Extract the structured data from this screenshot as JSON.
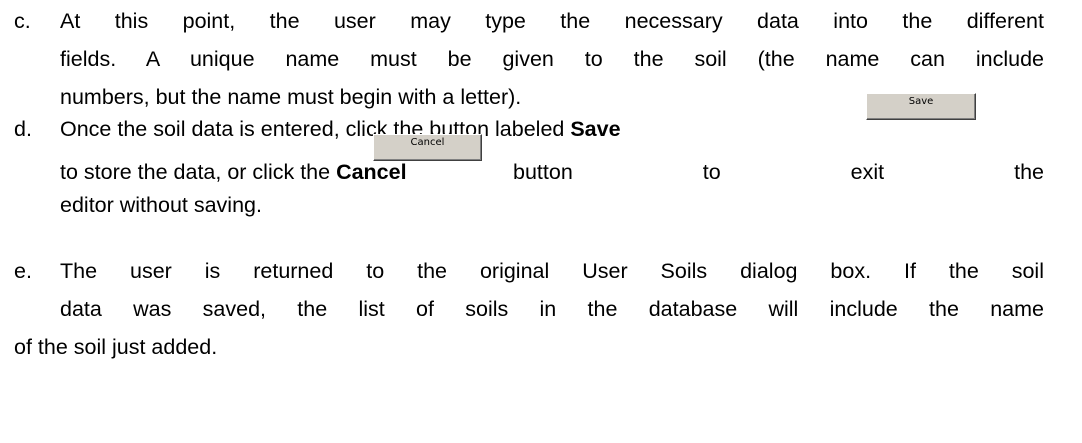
{
  "steps": [
    {
      "marker": "c.",
      "lines": [
        "At this point, the user may type the necessary data into the different",
        "fields. A unique name must be given to the soil (the name can include",
        "numbers, but the name must begin with a letter)."
      ]
    },
    {
      "marker": "d.",
      "line1_pre": "Once the soil data is entered, click the button labeled ",
      "line1_bold": "Save",
      "line2_pre": "to store the data, or click the ",
      "line2_bold": "Cancel",
      "line2_post": "button to exit the",
      "line3": "editor without saving.",
      "save_button_label": "Save",
      "cancel_button_label": "Cancel"
    },
    {
      "marker": "e.",
      "lines": [
        "The user is returned to the original User Soils dialog box. If the soil",
        "data was saved, the list of soils in the database will include the name",
        "of the soil just added."
      ]
    }
  ]
}
